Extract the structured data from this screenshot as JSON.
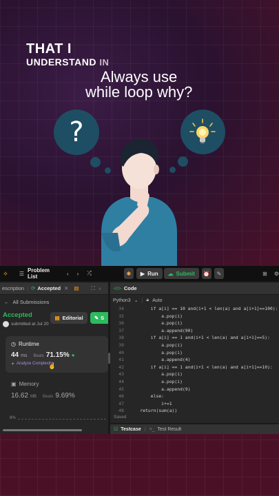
{
  "caption": {
    "line1": "THAT I",
    "line2": "UNDERSTAND",
    "line2_suffix": "IN",
    "line3": "Always use",
    "line4": "while loop why?"
  },
  "thought": {
    "question_glyph": "?",
    "lightbulb_icon": "lightbulb-icon"
  },
  "toolbar": {
    "problem_list": "Problem List",
    "run": "Run",
    "submit": "Submit"
  },
  "left": {
    "tab_description": "escription",
    "tab_accepted": "Accepted",
    "all_submissions": "All Submissions",
    "status": "Accepted",
    "submitted": "submitted at Jul 20",
    "editorial": "Editorial",
    "solution_btn": "S",
    "runtime_label": "Runtime",
    "runtime_value": "44",
    "runtime_unit": "ms",
    "beats_label": "Beats",
    "runtime_beats": "71.15%",
    "analyze": "Analyze Complexity",
    "memory_label": "Memory",
    "memory_value": "16.62",
    "memory_unit": "MB",
    "memory_beats": "9.69%",
    "chart_pct": "8%"
  },
  "right": {
    "code_tab": "Code",
    "language": "Python3",
    "auto": "Auto",
    "saved": "Saved",
    "testcase": "Testcase",
    "test_result": "Test Result",
    "lines": [
      {
        "n": "34",
        "t": "        if a[i] == 10 and(i+1 < len(a) and a[i+1]==100):"
      },
      {
        "n": "35",
        "t": "            a.pop(i)"
      },
      {
        "n": "36",
        "t": "            a.pop(i)"
      },
      {
        "n": "37",
        "t": "            a.append(90)"
      },
      {
        "n": "38",
        "t": "        if a[i] == 1 and(i+1 < len(a) and a[i+1]==5):"
      },
      {
        "n": "39",
        "t": "            a.pop(i)"
      },
      {
        "n": "40",
        "t": "            a.pop(i)"
      },
      {
        "n": "41",
        "t": "            a.append(4)"
      },
      {
        "n": "42",
        "t": "        if a[i] == 1 and(i+1 < len(a) and a[i+1]==10):"
      },
      {
        "n": "43",
        "t": "            a.pop(i)"
      },
      {
        "n": "44",
        "t": "            a.pop(i)"
      },
      {
        "n": "45",
        "t": "            a.append(9)"
      },
      {
        "n": "46",
        "t": "        else:"
      },
      {
        "n": "47",
        "t": "            i+=1"
      },
      {
        "n": "48",
        "t": "    return(sum(a))"
      }
    ]
  },
  "colors": {
    "accent_green": "#2cbb5d",
    "accepted_green": "#2cbb5d",
    "bubble": "#1e4e63"
  }
}
